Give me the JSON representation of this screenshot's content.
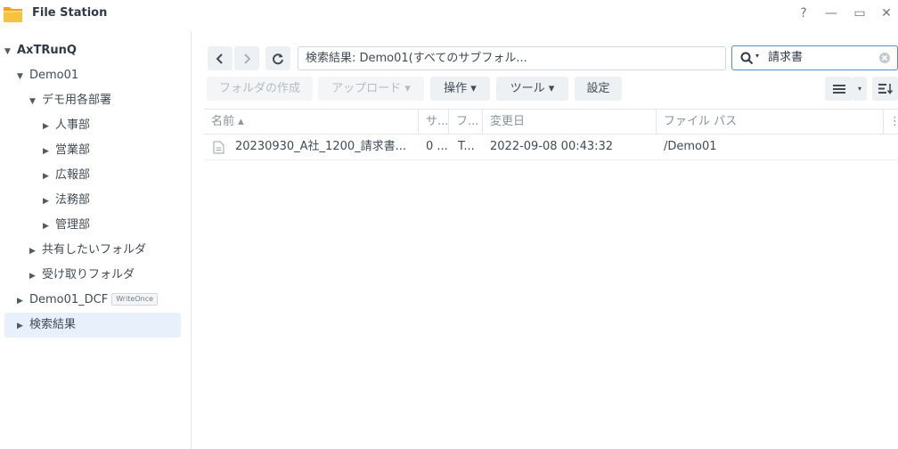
{
  "window": {
    "title": "File Station",
    "controls": {
      "help": "?",
      "minimize": "—",
      "maximize": "▭",
      "close": "✕"
    }
  },
  "sidebar": {
    "items": [
      {
        "label": "AxTRunQ",
        "arrow": "▼"
      },
      {
        "label": "Demo01",
        "arrow": "▼"
      },
      {
        "label": "デモ用各部署",
        "arrow": "▼"
      },
      {
        "label": "人事部",
        "arrow": "▶"
      },
      {
        "label": "営業部",
        "arrow": "▶"
      },
      {
        "label": "広報部",
        "arrow": "▶"
      },
      {
        "label": "法務部",
        "arrow": "▶"
      },
      {
        "label": "管理部",
        "arrow": "▶"
      },
      {
        "label": "共有したいフォルダ",
        "arrow": "▶"
      },
      {
        "label": "受け取りフォルダ",
        "arrow": "▶"
      },
      {
        "label": "Demo01_DCF",
        "arrow": "▶",
        "badge": "WriteOnce"
      },
      {
        "label": "検索結果",
        "arrow": "▶"
      }
    ]
  },
  "toolbar": {
    "path": "検索結果: Demo01(すべてのサブフォル...",
    "search_value": "請求書",
    "create_folder": "フォルダの作成",
    "upload": "アップロード ▾",
    "action": "操作 ▾",
    "tools": "ツール ▾",
    "settings": "設定"
  },
  "table": {
    "columns": [
      "名前 ▴",
      "サ...",
      "フ...",
      "変更日",
      "ファイル パス"
    ],
    "rows": [
      {
        "name": "20230930_A社_1200_請求書...",
        "size": "0 ...",
        "type": "T...",
        "modified": "2022-09-08 00:43:32",
        "path": "/Demo01"
      }
    ]
  },
  "colors": {
    "accent": "#4f8fd6",
    "selected": "#e7f0fb",
    "folder": "#f5b731"
  }
}
